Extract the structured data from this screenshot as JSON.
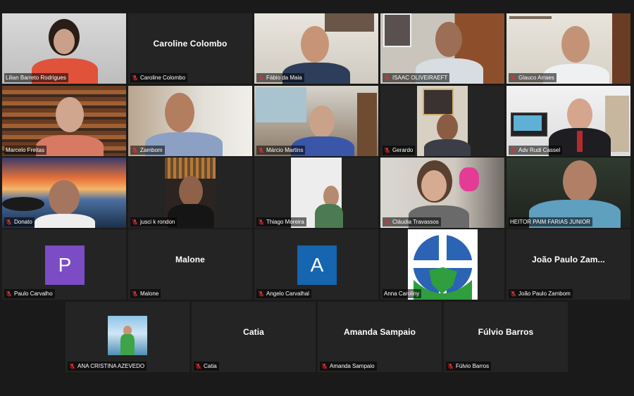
{
  "colors": {
    "background": "#1a1a1a",
    "tile": "#242424",
    "active_speaker_border": "#c6e84a",
    "mic_muted": "#e02f2f",
    "avatar_p": "#7b4cc4",
    "avatar_a": "#1565b0"
  },
  "participants": [
    {
      "name": "Lilian Barreto Rodrigues",
      "muted": false,
      "active_speaker": true
    },
    {
      "name": "Caroline Colombo",
      "display": "Caroline Colombo",
      "muted": true
    },
    {
      "name": "Fábio da Maia",
      "muted": true
    },
    {
      "name": "ISAAC OLIVEIRAEFT",
      "muted": true
    },
    {
      "name": "Glauco Arraes",
      "muted": true
    },
    {
      "name": "Marcelo Freitas",
      "muted": false
    },
    {
      "name": "Zambom",
      "muted": true
    },
    {
      "name": "Márcio Martins",
      "muted": true
    },
    {
      "name": "Gerardo",
      "muted": true
    },
    {
      "name": "Adv Rudi Cassel",
      "muted": true
    },
    {
      "name": "Donato",
      "muted": true
    },
    {
      "name": "jusci k rondon",
      "muted": true
    },
    {
      "name": "Thiago Moreira",
      "muted": true
    },
    {
      "name": "Cláudia Travassos",
      "muted": true
    },
    {
      "name": "HEITOR PAIM FARIAS JUNIOR",
      "muted": false
    },
    {
      "name": "Paulo Carvalho",
      "avatar_letter": "P",
      "muted": true
    },
    {
      "name": "Malone",
      "display": "Malone",
      "muted": true
    },
    {
      "name": "Angelo Carvalhal",
      "avatar_letter": "A",
      "muted": true
    },
    {
      "name": "Anna Caroliny",
      "muted": false
    },
    {
      "name": "João Paulo Zambom",
      "display": "João Paulo Zam...",
      "muted": true
    },
    {
      "name": "ANA CRISTINA AZEVEDO",
      "muted": true
    },
    {
      "name": "Catia",
      "display": "Catia",
      "muted": true
    },
    {
      "name": "Amanda Sampaio",
      "display": "Amanda Sampaio",
      "muted": true
    },
    {
      "name": "Fúlvio Barros",
      "display": "Fúlvio Barros",
      "muted": true
    }
  ]
}
